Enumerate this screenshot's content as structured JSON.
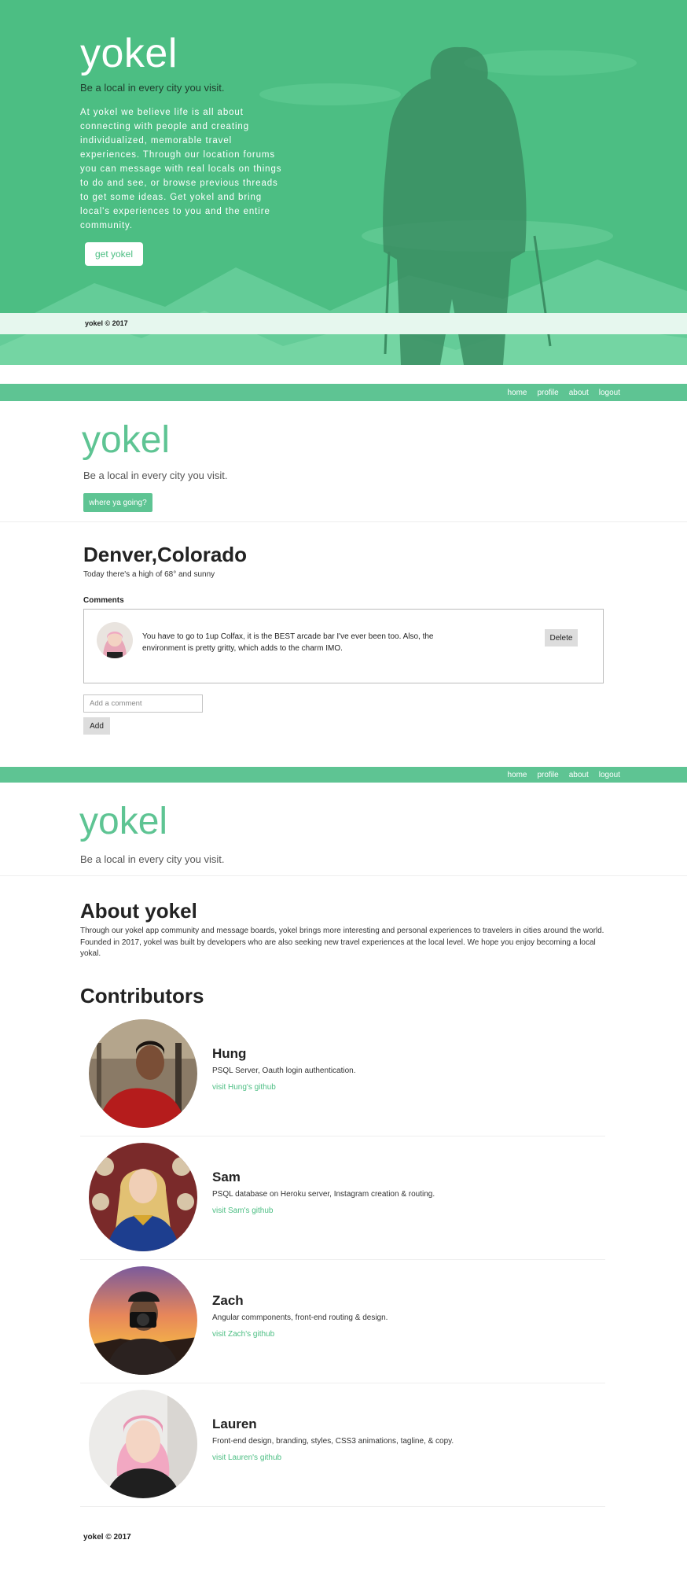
{
  "hero": {
    "title": "yokel",
    "tagline": "Be a local in every city you visit.",
    "description": "At yokel we believe life is all about connecting with people and creating individualized, memorable travel experiences. Through our location forums you can message with real locals on things to do and see, or browse previous threads to get some ideas. Get yokel and bring local's experiences to you and the entire community.",
    "cta_label": "get yokel",
    "footer": "yokel © 2017"
  },
  "nav": {
    "items": [
      "home",
      "profile",
      "about",
      "logout"
    ]
  },
  "city_page": {
    "brand": "yokel",
    "tagline": "Be a local in every city you visit.",
    "where_button": "where ya going?",
    "city": "Denver,Colorado",
    "weather": "Today there's a high of 68° and sunny",
    "comments_heading": "Comments",
    "comments": [
      {
        "text": "You have to go to 1up Colfax, it is the BEST arcade bar I've ever been too. Also, the environment is pretty gritty, which adds to the charm IMO.",
        "delete_label": "Delete"
      }
    ],
    "comment_placeholder": "Add a comment",
    "add_label": "Add"
  },
  "about_page": {
    "brand": "yokel",
    "tagline": "Be a local in every city you visit.",
    "heading": "About yokel",
    "body": "Through our yokel app community and message boards, yokel brings more interesting and personal experiences to travelers in cities around the world. Founded in 2017, yokel was built by developers who are also seeking new travel experiences at the local level. We hope you enjoy becoming a local yokal.",
    "contributors_heading": "Contributors",
    "contributors": [
      {
        "name": "Hung",
        "role": "PSQL Server, Oauth login authentication.",
        "link": "visit Hung's github"
      },
      {
        "name": "Sam",
        "role": "PSQL database on Heroku server, Instagram creation & routing.",
        "link": "visit Sam's github"
      },
      {
        "name": "Zach",
        "role": "Angular commponents, front-end routing & design.",
        "link": "visit Zach's github"
      },
      {
        "name": "Lauren",
        "role": "Front-end design, branding, styles, CSS3 animations, tagline, & copy.",
        "link": "visit Lauren's github"
      }
    ],
    "footer": "yokel © 2017"
  },
  "colors": {
    "brand_green": "#5ec493",
    "hero_green": "#4cbe83",
    "link_green": "#4cbe83"
  }
}
